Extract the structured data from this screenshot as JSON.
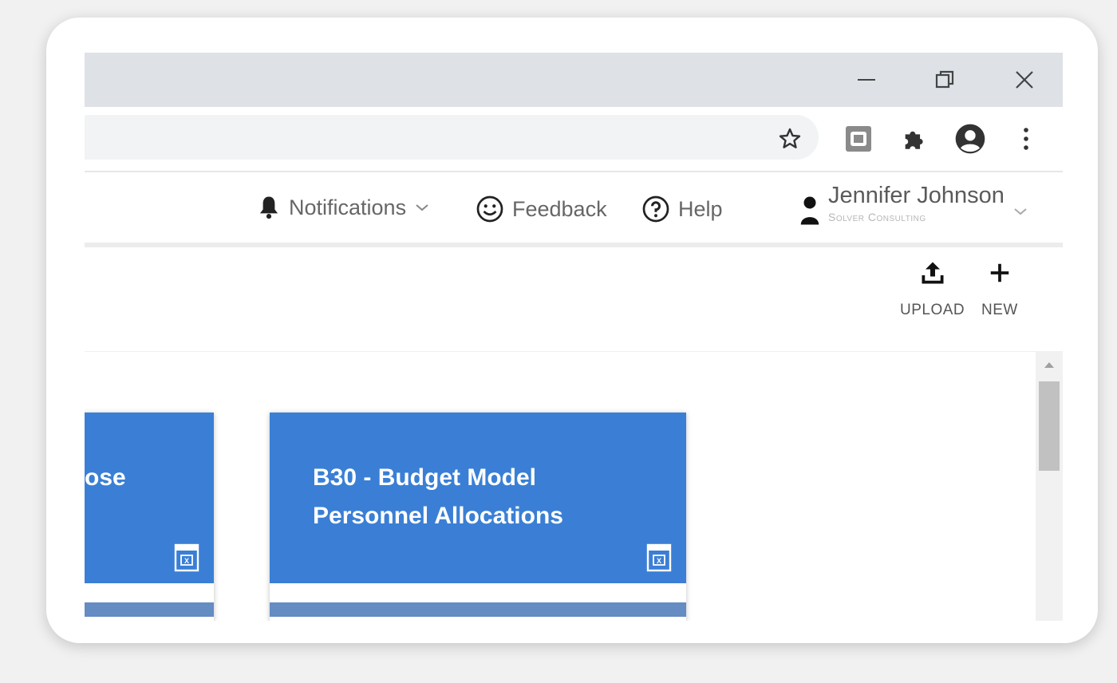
{
  "window": {
    "minimize_icon": "minimize-icon",
    "restore_icon": "restore-icon",
    "close_icon": "close-icon"
  },
  "toolbar": {
    "icons": [
      "star-icon",
      "extension-app-icon",
      "puzzle-icon",
      "profile-icon",
      "kebab-menu-icon"
    ]
  },
  "header": {
    "notifications_label": "Notifications",
    "feedback_label": "Feedback",
    "help_label": "Help",
    "user_name": "Jennifer Johnson",
    "user_org": "Solver Consulting"
  },
  "actions": {
    "upload_label": "UPLOAD",
    "new_label": "NEW"
  },
  "cards": [
    {
      "title": "ose"
    },
    {
      "title_line1": "B30 - Budget Model",
      "title_line2": "Personnel Allocations"
    }
  ],
  "colors": {
    "card_blue": "#3a7fd5",
    "titlebar": "#dee1e6"
  }
}
